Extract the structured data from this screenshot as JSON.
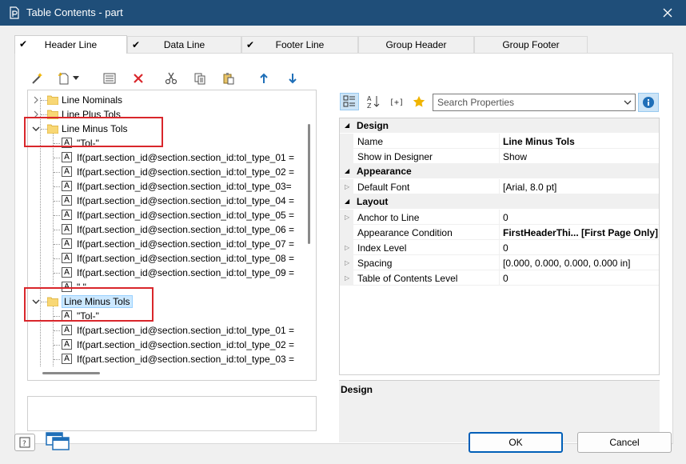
{
  "window": {
    "title": "Table Contents - part"
  },
  "tabs": [
    {
      "label": "Header Line",
      "checked": true,
      "active": true
    },
    {
      "label": "Data Line",
      "checked": true,
      "active": false
    },
    {
      "label": "Footer Line",
      "checked": true,
      "active": false
    },
    {
      "label": "Group Header",
      "checked": false,
      "active": false
    },
    {
      "label": "Group Footer",
      "checked": false,
      "active": false
    }
  ],
  "tree": {
    "items": [
      {
        "label": "Line Nominals",
        "type": "folder",
        "expanded": false
      },
      {
        "label": "Line Plus Tols",
        "type": "folder",
        "expanded": false
      },
      {
        "label": "Line Minus Tols",
        "type": "folder",
        "expanded": true
      },
      {
        "label": "\"Tol-\"",
        "type": "text"
      },
      {
        "label": "If(part.section_id@section.section_id:tol_type_01 =",
        "type": "text"
      },
      {
        "label": "If(part.section_id@section.section_id:tol_type_02 =",
        "type": "text"
      },
      {
        "label": "If(part.section_id@section.section_id:tol_type_03=",
        "type": "text"
      },
      {
        "label": "If(part.section_id@section.section_id:tol_type_04 =",
        "type": "text"
      },
      {
        "label": "If(part.section_id@section.section_id:tol_type_05 =",
        "type": "text"
      },
      {
        "label": "If(part.section_id@section.section_id:tol_type_06 =",
        "type": "text"
      },
      {
        "label": "If(part.section_id@section.section_id:tol_type_07 =",
        "type": "text"
      },
      {
        "label": "If(part.section_id@section.section_id:tol_type_08 =",
        "type": "text"
      },
      {
        "label": "If(part.section_id@section.section_id:tol_type_09 =",
        "type": "text"
      },
      {
        "label": "\" \"",
        "type": "text"
      },
      {
        "label": "Line Minus Tols",
        "type": "folder",
        "expanded": true,
        "selected": true
      },
      {
        "label": "\"Tol-\"",
        "type": "text"
      },
      {
        "label": "If(part.section_id@section.section_id:tol_type_01 =",
        "type": "text"
      },
      {
        "label": "If(part.section_id@section.section_id:tol_type_02 =",
        "type": "text"
      },
      {
        "label": "If(part.section_id@section.section_id:tol_type_03 =",
        "type": "text"
      }
    ]
  },
  "search": {
    "placeholder": "Search Properties"
  },
  "properties": {
    "categories": [
      {
        "name": "Design",
        "rows": [
          {
            "name": "Name",
            "value": "Line Minus Tols",
            "bold": true,
            "expandable": false
          },
          {
            "name": "Show in Designer",
            "value": "Show",
            "bold": false,
            "expandable": false
          }
        ]
      },
      {
        "name": "Appearance",
        "rows": [
          {
            "name": "Default Font",
            "value": "[Arial, 8.0 pt]",
            "bold": false,
            "expandable": true
          }
        ]
      },
      {
        "name": "Layout",
        "rows": [
          {
            "name": "Anchor to Line",
            "value": "0",
            "bold": false,
            "expandable": true
          },
          {
            "name": "Appearance Condition",
            "value": "FirstHeaderThi...   [First Page Only]",
            "bold": true,
            "expandable": false
          },
          {
            "name": "Index Level",
            "value": "0",
            "bold": false,
            "expandable": true
          },
          {
            "name": "Spacing",
            "value": "[0.000, 0.000, 0.000, 0.000 in]",
            "bold": false,
            "expandable": true
          },
          {
            "name": "Table of Contents Level",
            "value": "0",
            "bold": false,
            "expandable": true
          }
        ]
      }
    ]
  },
  "description": {
    "title": "Design"
  },
  "buttons": {
    "ok": "OK",
    "cancel": "Cancel"
  },
  "colors": {
    "titlebar": "#1f4e79",
    "callout": "#d9262b",
    "selection": "#cce8ff",
    "accent": "#005fb8"
  }
}
